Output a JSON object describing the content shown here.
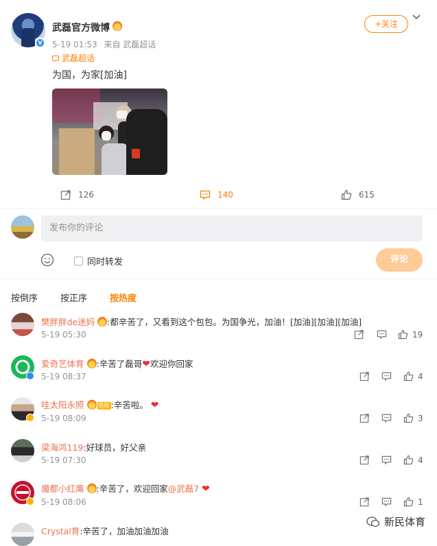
{
  "post": {
    "author": "武磊官方微博",
    "time": "5-19 01:53",
    "source": "来自 武磊超话",
    "topic": "武磊超话",
    "content": "为国，为家[加油]",
    "follow_label": "+关注",
    "forward_count": "126",
    "comment_count": "140",
    "like_count": "615"
  },
  "composer": {
    "placeholder": "发布你的评论",
    "also_forward": "同时转发",
    "submit": "评论"
  },
  "sort": {
    "desc": "按倒序",
    "asc": "按正序",
    "hot": "按热度"
  },
  "comments": [
    {
      "name": "樊胖胖de迷妈",
      "text": ":都辛苦了，又看到这个包包。为国争光，加油！[加油][加油][加油]",
      "time": "5-19 05:30",
      "likes": "19"
    },
    {
      "name": "爱奇艺体育",
      "text": ":辛苦了磊哥",
      "tail": "欢迎你回家",
      "time": "5-19 08:37",
      "likes": "4"
    },
    {
      "name": "哇太阳永照",
      "badge": "铁粉",
      "text": ":辛苦啦。",
      "time": "5-19 08:09",
      "likes": "3"
    },
    {
      "name": "梁海鸿119",
      "text": ":好球员，好父亲",
      "time": "5-19 07:30",
      "likes": "4"
    },
    {
      "name": "魔都小红鹰",
      "text": ":辛苦了，欢迎回家",
      "mention": "@武磊7",
      "time": "5-19 08:06",
      "likes": "1"
    },
    {
      "name": "Crystal育",
      "text": ":辛苦了，加油加油加油"
    }
  ],
  "watermark": "新民体育",
  "colors": {
    "accent": "#ff8200",
    "name": "#eb7350",
    "verified": "#2f8cf0",
    "heart": "#e8312f"
  }
}
